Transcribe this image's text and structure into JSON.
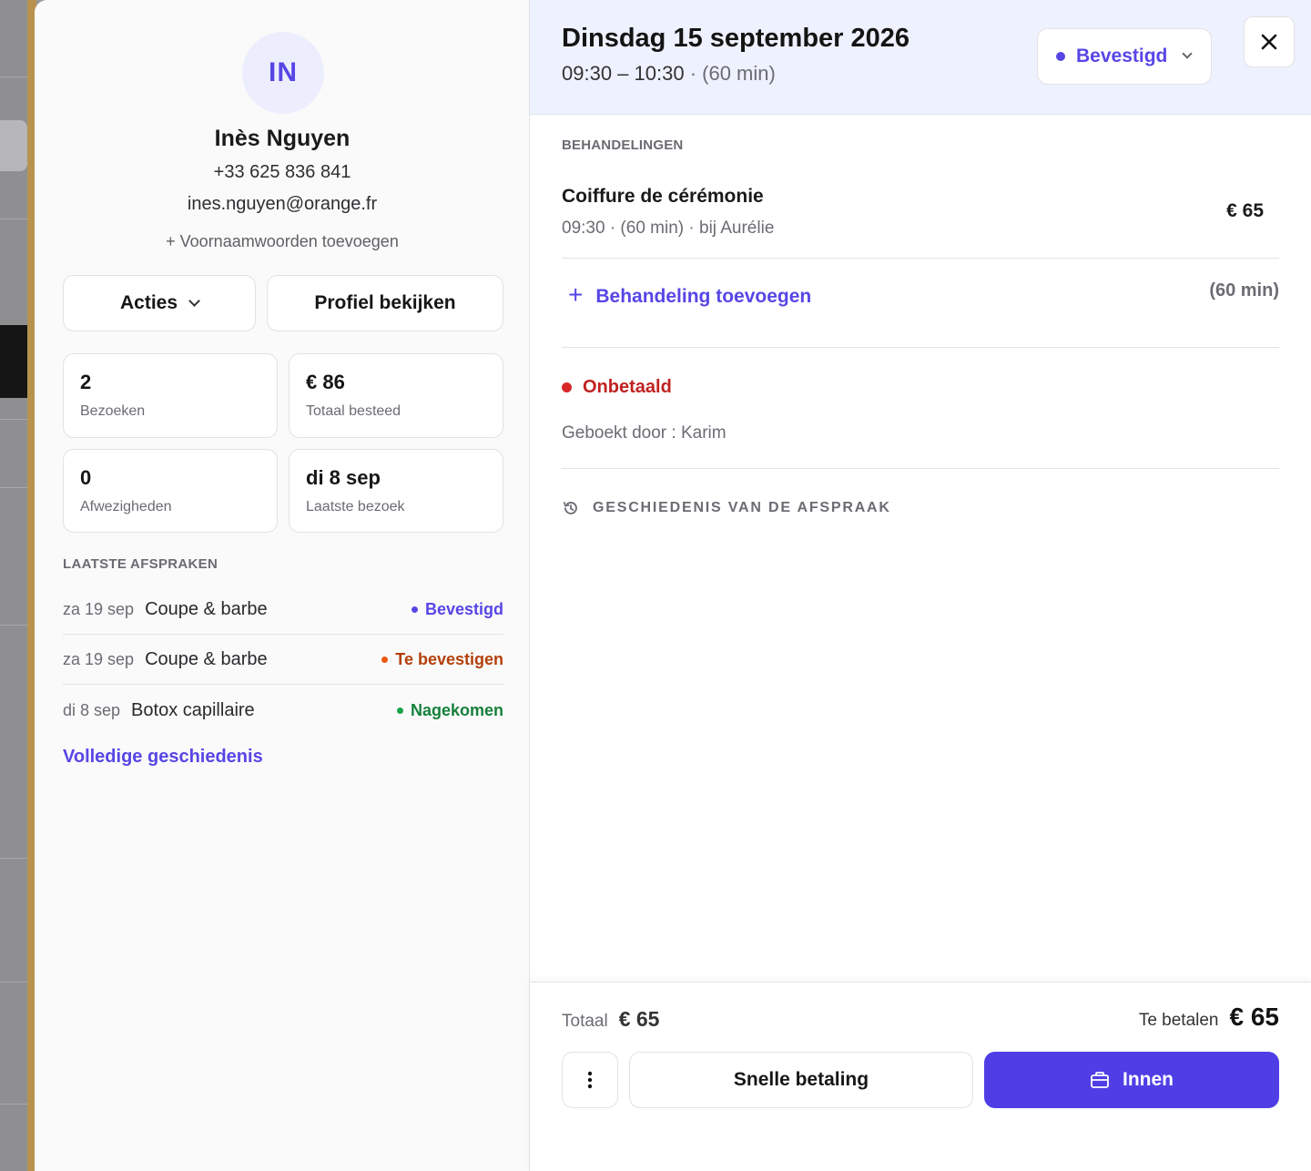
{
  "client": {
    "initials": "IN",
    "name": "Inès Nguyen",
    "phone": "+33 625 836 841",
    "email": "ines.nguyen@orange.fr",
    "pronouns_link": "+ Voornaamwoorden toevoegen"
  },
  "actions": {
    "acties_label": "Acties",
    "profile_label": "Profiel bekijken"
  },
  "stats": [
    {
      "value": "2",
      "label": "Bezoeken"
    },
    {
      "value": "€ 86",
      "label": "Totaal besteed"
    },
    {
      "value": "0",
      "label": "Afwezigheden"
    },
    {
      "value": "di 8 sep",
      "label": "Laatste bezoek"
    }
  ],
  "recent": {
    "title": "LAATSTE AFSPRAKEN",
    "items": [
      {
        "date": "za 19 sep",
        "service": "Coupe & barbe",
        "status": "Bevestigd",
        "color": "#5746e6"
      },
      {
        "date": "za 19 sep",
        "service": "Coupe & barbe",
        "status": "Te bevestigen",
        "color": "#b3400c"
      },
      {
        "date": "di 8 sep",
        "service": "Botox capillaire",
        "status": "Nagekomen",
        "color": "#16803c"
      }
    ],
    "history_link": "Volledige geschiedenis"
  },
  "appointment": {
    "date": "Dinsdag 15 september 2026",
    "time": "09:30 – 10:30",
    "duration": "· (60 min)",
    "status": "Bevestigd"
  },
  "treatments": {
    "title": "BEHANDELINGEN",
    "items": [
      {
        "name": "Coiffure de cérémonie",
        "meta": "09:30 · (60 min) · bij Aurélie",
        "price": "€ 65"
      }
    ],
    "add_label": "Behandeling toevoegen",
    "add_duration": "(60 min)"
  },
  "payment": {
    "state": "Onbetaald",
    "booked_by": "Geboekt door : Karim"
  },
  "history": {
    "label": "GESCHIEDENIS VAN DE AFSPRAAK"
  },
  "footer": {
    "total_label": "Totaal",
    "total_value": "€ 65",
    "topay_label": "Te betalen",
    "topay_value": "€ 65",
    "quick_pay": "Snelle betaling",
    "collect": "Innen"
  },
  "colors": {
    "accent": "#5746e6",
    "primary_button": "#4f3ee6",
    "unpaid": "#c02121",
    "header_bg": "#eef1fe"
  }
}
